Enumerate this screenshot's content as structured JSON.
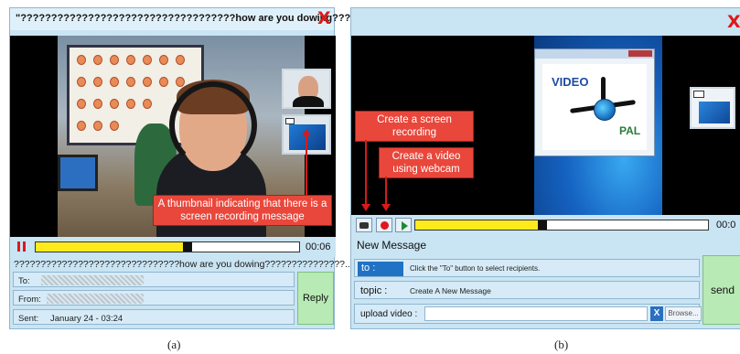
{
  "panel_a": {
    "title": "\"???????????????????????????????????how are you dowing????????X??",
    "close_glyph": "X",
    "callout": "A thumbnail indicating that there is a screen recording message",
    "time": "00:06",
    "progress_fraction": 0.56,
    "subject": "???????????????????????????????how are you dowing???????????????...",
    "to_label": "To:",
    "from_label": "From:",
    "sent_label": "Sent:",
    "sent_value": "January 24 - 03:24",
    "reply_label": "Reply",
    "caption": "(a)",
    "icons": {
      "pause": "pause-icon",
      "close": "close-icon"
    }
  },
  "panel_b": {
    "close_glyph": "X",
    "callout_screen": "Create a screen recording",
    "callout_webcam": "Create a video using webcam",
    "logo_video": "VIDEO",
    "logo_pal": "PAL",
    "time": "00:0",
    "progress_fraction": 0.42,
    "new_message": "New Message",
    "to_label": "to :",
    "to_hint": "Click the \"To\" button to select recipients.",
    "topic_label": "topic :",
    "topic_value": "Create A New Message",
    "upload_label": "upload video :",
    "clear_glyph": "X",
    "browse_label": "Browse...",
    "send_label": "send",
    "caption": "(b)",
    "icons": {
      "screen": "screen-record-icon",
      "record": "record-icon",
      "play": "play-icon"
    }
  },
  "colors": {
    "accent_red": "#e0171d",
    "callout_red": "#e9473b",
    "progress_yellow": "#ffeb1c",
    "button_green": "#b8eab5",
    "panel_blue": "#c9e4f3"
  }
}
